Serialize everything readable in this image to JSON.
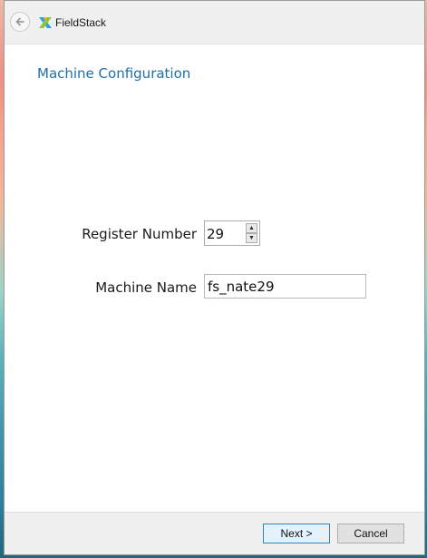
{
  "window": {
    "app_title": "FieldStack"
  },
  "page": {
    "title": "Machine Configuration"
  },
  "form": {
    "register_label": "Register Number",
    "register_value": "29",
    "machine_name_label": "Machine Name",
    "machine_name_value": "fs_nate29"
  },
  "footer": {
    "next_label": "Next >",
    "cancel_label": "Cancel"
  },
  "colors": {
    "accent": "#1f6fa8"
  },
  "icons": {
    "back": "back-arrow-icon",
    "logo": "fieldstack-logo-icon",
    "spin_up": "caret-up-icon",
    "spin_down": "caret-down-icon"
  }
}
